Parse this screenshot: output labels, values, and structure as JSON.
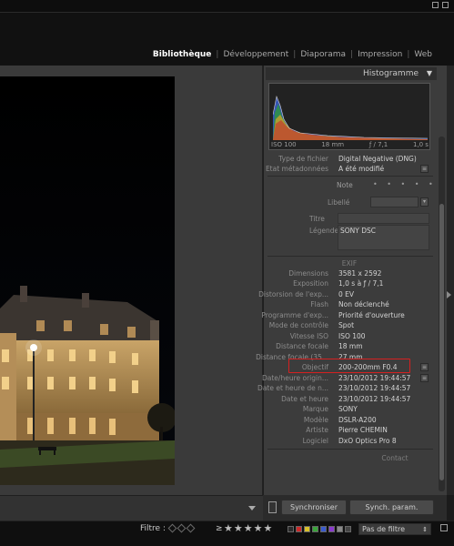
{
  "modules": [
    {
      "label": "Bibliothèque",
      "active": true
    },
    {
      "label": "Développement",
      "active": false
    },
    {
      "label": "Diaporama",
      "active": false
    },
    {
      "label": "Impression",
      "active": false
    },
    {
      "label": "Web",
      "active": false
    }
  ],
  "histogram": {
    "title": "Histogramme",
    "toggle": "▼",
    "iso": "ISO 100",
    "focal": "18 mm",
    "aperture": "ƒ / 7,1",
    "shutter": "1,0 s"
  },
  "metadata_top": {
    "type_label": "Type de fichier",
    "type_value": "Digital Negative (DNG)",
    "etat_label": "Etat métadonnées",
    "etat_value": "A été modifié",
    "note_label": "Note",
    "note_dots": "• • • • •",
    "libelle_label": "Libellé",
    "titre_label": "Titre",
    "legende_label": "Légende",
    "legende_value": "SONY DSC"
  },
  "exif": {
    "section_label": "EXIF",
    "rows": [
      {
        "label": "Dimensions",
        "value": "3581 x 2592"
      },
      {
        "label": "Exposition",
        "value": "1,0 s à ƒ / 7,1"
      },
      {
        "label": "Distorsion de l'exp...",
        "value": "0 EV"
      },
      {
        "label": "Flash",
        "value": "Non déclenché"
      },
      {
        "label": "Programme d'exp...",
        "value": "Priorité d'ouverture"
      },
      {
        "label": "Mode de contrôle",
        "value": "Spot"
      },
      {
        "label": "Vitesse ISO",
        "value": "ISO 100"
      },
      {
        "label": "Distance focale",
        "value": "18 mm"
      },
      {
        "label": "Distance focale (35...",
        "value": "27 mm"
      },
      {
        "label": "Objectif",
        "value": "200-200mm F0.4"
      },
      {
        "label": "Date/heure origin...",
        "value": "23/10/2012 19:44:57"
      },
      {
        "label": "Date et heure de n...",
        "value": "23/10/2012 19:44:57"
      },
      {
        "label": "Date et heure",
        "value": "23/10/2012 19:44:57"
      },
      {
        "label": "Marque",
        "value": "SONY"
      },
      {
        "label": "Modèle",
        "value": "DSLR-A200"
      },
      {
        "label": "Artiste",
        "value": "Pierre CHEMIN"
      },
      {
        "label": "Logiciel",
        "value": "DxO Optics Pro 8"
      }
    ],
    "contact_label": "Contact"
  },
  "sync": {
    "button1": "Synchroniser",
    "button2": "Synch. param."
  },
  "filter": {
    "label": "Filtre :",
    "gte": "≥",
    "stars": "★★★★★",
    "select_value": "Pas de filtre",
    "select_caret": "⇕"
  },
  "colors": {
    "label_chips": [
      "#2b2b2b",
      "#cc2a2a",
      "#d8c02a",
      "#3aa43a",
      "#3a5acc",
      "#8a3acc",
      "#8a8a8a",
      "#444444"
    ]
  }
}
